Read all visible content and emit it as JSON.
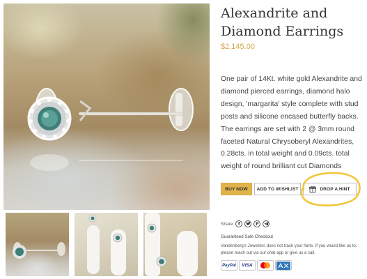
{
  "gallery": {
    "main_image": "product-photo",
    "thumbnails": [
      "thumbnail-1",
      "thumbnail-2",
      "thumbnail-3"
    ]
  },
  "product": {
    "title_line1": "Alexandrite and",
    "title_line2": "Diamond Earrings",
    "price": "$2,145.00",
    "description": "One pair of 14Kt. white gold Alexandrite and diamond pierced earrings, diamond halo design, 'margarita' style complete with stud posts and silicone encased butterfly backs. The earrings are set with 2 @ 3mm round faceted Natural Chrysoberyl Alexandrites, 0.28cts. in total weight and 0.09cts. total weight of round brilliant cut Diamonds"
  },
  "actions": {
    "buy_now": "BUY NOW",
    "add_to_wishlist": "ADD TO WISHLIST",
    "drop_a_hint": "DROP A HINT"
  },
  "share": {
    "label": "Share",
    "networks": [
      "facebook-icon",
      "twitter-icon",
      "pinterest-icon",
      "telegram-icon"
    ]
  },
  "checkout": {
    "title": "Guaranteed Safe Checkout",
    "note": "Vandenberg's Jewellers does not track your hints. If you would like us to, please reach out via our chat app or give us a call."
  },
  "payments": {
    "paypal": "PayPal",
    "visa": "VISA",
    "items": [
      "paypal-badge",
      "visa-badge",
      "mastercard-badge",
      "amex-badge"
    ]
  },
  "colors": {
    "accent_gold": "#e0b44b",
    "price_gold": "#d4a84e",
    "highlight_circle": "#f2c63a",
    "gem_green": "#3f7f78"
  }
}
